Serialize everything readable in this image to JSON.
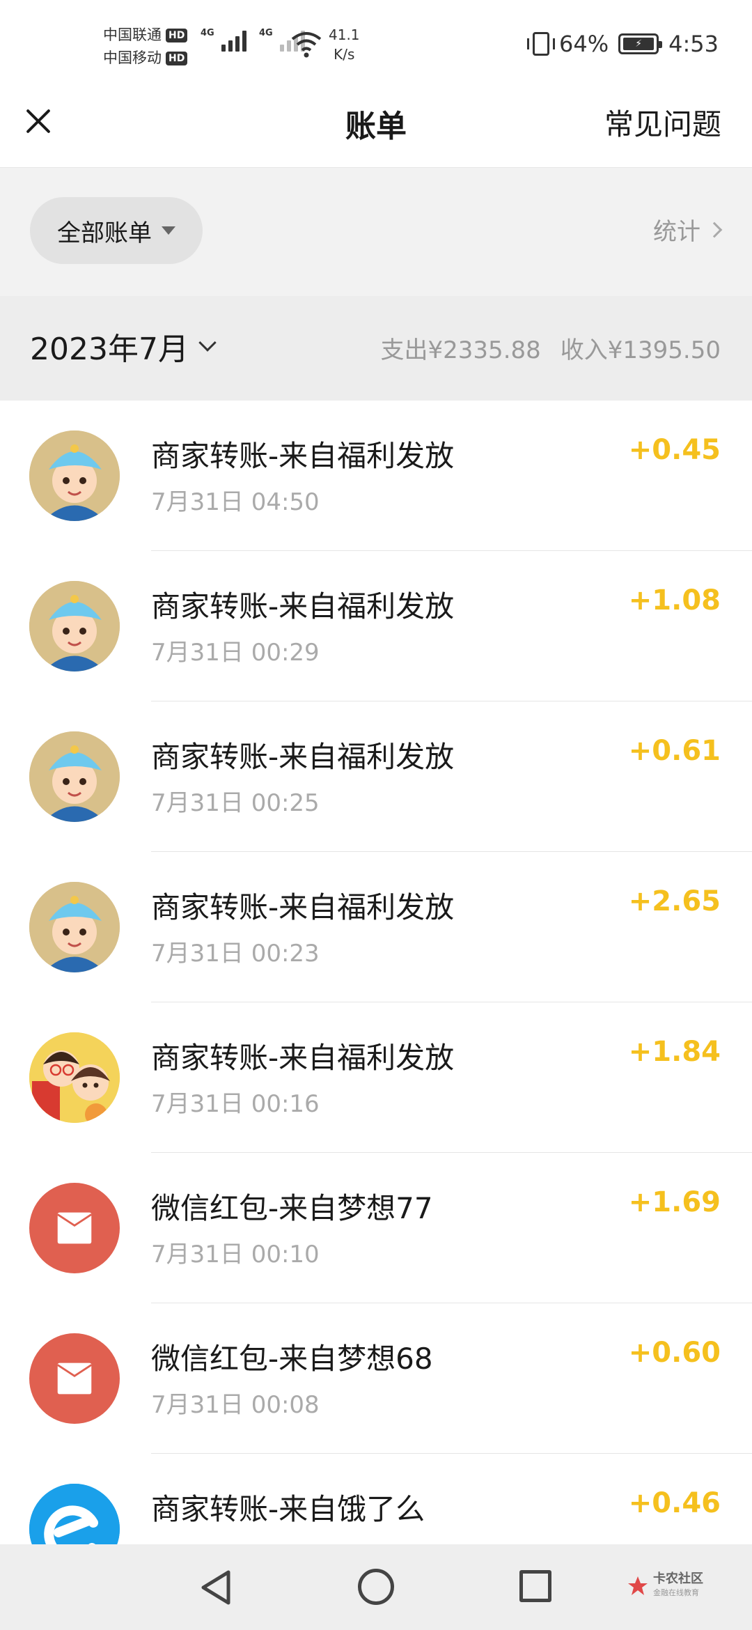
{
  "status_bar": {
    "carrier1": "中国联通",
    "carrier2": "中国移动",
    "hd": "HD",
    "network": "4G",
    "net_speed_value": "41.1",
    "net_speed_unit": "K/s",
    "battery_percent": "64%",
    "time": "4:53"
  },
  "nav": {
    "close_icon": "close-icon",
    "title": "账单",
    "faq": "常见问题"
  },
  "filter": {
    "all_bills": "全部账单",
    "stats": "统计"
  },
  "month_bar": {
    "month": "2023年7月",
    "expense": "支出¥2335.88",
    "income": "收入¥1395.50"
  },
  "transactions": [
    {
      "title": "商家转账-来自福利发放",
      "time": "7月31日 04:50",
      "amount": "+0.45",
      "avatar": "cartoon-boy"
    },
    {
      "title": "商家转账-来自福利发放",
      "time": "7月31日 00:29",
      "amount": "+1.08",
      "avatar": "cartoon-boy"
    },
    {
      "title": "商家转账-来自福利发放",
      "time": "7月31日 00:25",
      "amount": "+0.61",
      "avatar": "cartoon-boy"
    },
    {
      "title": "商家转账-来自福利发放",
      "time": "7月31日 00:23",
      "amount": "+2.65",
      "avatar": "cartoon-boy"
    },
    {
      "title": "商家转账-来自福利发放",
      "time": "7月31日 00:16",
      "amount": "+1.84",
      "avatar": "cartoon-couple"
    },
    {
      "title": "微信红包-来自梦想77",
      "time": "7月31日 00:10",
      "amount": "+1.69",
      "avatar": "red-packet"
    },
    {
      "title": "微信红包-来自梦想68",
      "time": "7月31日 00:08",
      "amount": "+0.60",
      "avatar": "red-packet"
    },
    {
      "title": "商家转账-来自饿了么",
      "time": "",
      "amount": "+0.46",
      "avatar": "eleme-logo"
    }
  ],
  "watermark": {
    "name": "卡农社区",
    "sub": "金融在线教育"
  },
  "colors": {
    "amount": "#f5c01e",
    "red_packet": "#e06050",
    "eleme": "#1aa0ea",
    "page_bg_gray": "#ededed"
  }
}
